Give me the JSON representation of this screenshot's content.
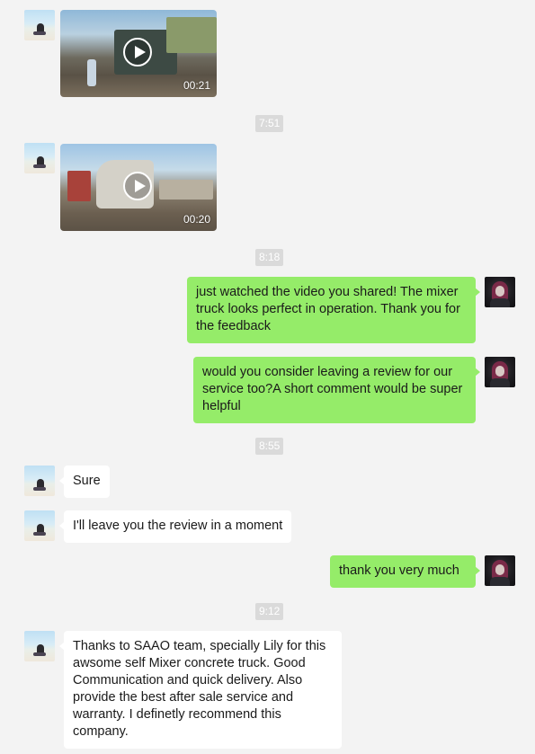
{
  "messages": {
    "video1": {
      "duration": "00:21"
    },
    "time1": "7:51",
    "video2": {
      "duration": "00:20"
    },
    "time2": "8:18",
    "out1": "just watched the video you shared! The mixer truck looks perfect in operation. Thank you for the feedback",
    "out2": "would you consider leaving a review for our service too?A short comment would be super helpful",
    "time3": "8:55",
    "in1": "Sure",
    "in2": "I'll leave you the review in a moment",
    "out3": "thank you very much",
    "time4": "9:12",
    "in3": "Thanks to SAAO team, specially Lily for this awsome self Mixer concrete truck. Good Communication and quick delivery. Also provide the best after sale service and warranty. I definetly recommend this company."
  },
  "colors": {
    "outgoing_bubble": "#95ec69",
    "incoming_bubble": "#ffffff",
    "background": "#f3f3f3"
  }
}
